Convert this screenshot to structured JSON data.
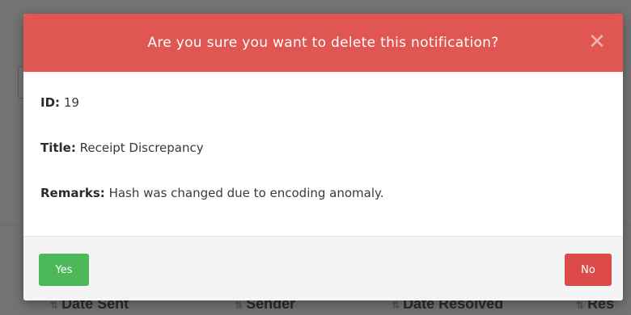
{
  "background": {
    "column_headers": [
      {
        "label": "Date Sent"
      },
      {
        "label": "Sender"
      },
      {
        "label": "Date Resolved"
      },
      {
        "label": "Res"
      }
    ],
    "sort_icon": "sort-arrows-icon"
  },
  "modal": {
    "title": "Are you sure you want to delete this notification?",
    "close_icon": "close-icon",
    "close_glyph": "✕",
    "fields": {
      "id": {
        "label": "ID:",
        "value": "19"
      },
      "title": {
        "label": "Title:",
        "value": "Receipt Discrepancy"
      },
      "remarks": {
        "label": "Remarks:",
        "value": "Hash was changed due to encoding anomaly."
      }
    },
    "buttons": {
      "yes": "Yes",
      "no": "No"
    }
  },
  "colors": {
    "header": "#e05653",
    "yes": "#4cb85a",
    "no": "#dc4b4a"
  }
}
